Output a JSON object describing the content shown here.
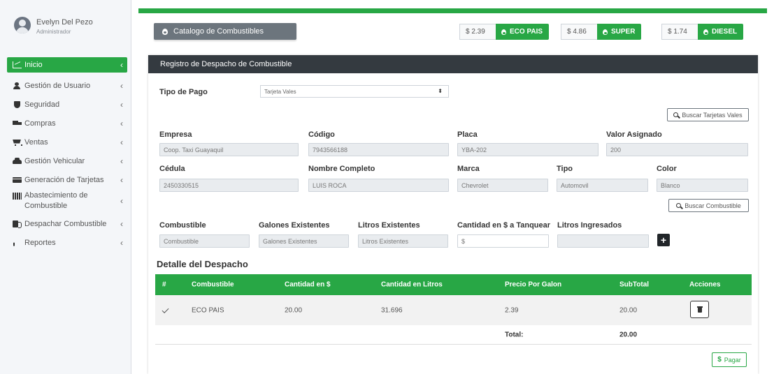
{
  "user": {
    "name": "Evelyn Del Pezo",
    "role": "Administrador"
  },
  "sidebar": {
    "items": [
      {
        "label": "Inicio",
        "icon": "chart-line-icon",
        "active": true
      },
      {
        "label": "Gestión de Usuario",
        "icon": "user-icon"
      },
      {
        "label": "Seguridad",
        "icon": "shield-icon"
      },
      {
        "label": "Compras",
        "icon": "truck-icon"
      },
      {
        "label": "Ventas",
        "icon": "cart-icon"
      },
      {
        "label": "Gestión Vehicular",
        "icon": "car-icon"
      },
      {
        "label": "Generación de Tarjetas",
        "icon": "credit-card-icon"
      },
      {
        "label": "Abastecimiento de Combustible",
        "icon": "fuel-station-icon"
      },
      {
        "label": "Despachar Combustible",
        "icon": "fuel-dispenser-icon"
      },
      {
        "label": "Reportes",
        "icon": "bar-chart-icon"
      }
    ]
  },
  "header": {
    "catalog_button": "Catalogo de Combustibles",
    "prices": [
      {
        "value": "$ 2.39",
        "label": "ECO PAIS"
      },
      {
        "value": "$ 4.86",
        "label": "SUPER"
      },
      {
        "value": "$ 1.74",
        "label": "DIESEL"
      }
    ]
  },
  "form": {
    "title": "Registro de Despacho de Combustible",
    "tipo_pago_label": "Tipo de Pago",
    "tipo_pago_value": "Tarjeta Vales",
    "buscar_tarjetas": "Buscar Tarjetas Vales",
    "empresa_label": "Empresa",
    "empresa_value": "Coop. Taxi Guayaquil",
    "codigo_label": "Código",
    "codigo_value": "7943566188",
    "placa_label": "Placa",
    "placa_value": "YBA-202",
    "valor_label": "Valor Asignado",
    "valor_value": "200",
    "cedula_label": "Cédula",
    "cedula_value": "2450330515",
    "nombre_label": "Nombre Completo",
    "nombre_value": "LUIS ROCA",
    "marca_label": "Marca",
    "marca_value": "Chevrolet",
    "tipo_label": "Tipo",
    "tipo_value": "Automovil",
    "color_label": "Color",
    "color_value": "Blanco",
    "buscar_combustible": "Buscar Combustible",
    "combustible_label": "Combustible",
    "combustible_placeholder": "Combustible",
    "galones_label": "Galones Existentes",
    "galones_placeholder": "Galones Existentes",
    "litros_label": "Litros Existentes",
    "litros_placeholder": "Litros Existentes",
    "cantidad_label": "Cantidad en $ a Tanquear",
    "cantidad_placeholder": "$",
    "litros_ing_label": "Litros Ingresados",
    "add_button": "+"
  },
  "detail": {
    "title": "Detalle del Despacho",
    "columns": [
      "#",
      "Combustible",
      "Cantidad en $",
      "Cantidad en Litros",
      "Precio Por Galon",
      "SubTotal",
      "Acciones"
    ],
    "rows": [
      {
        "combustible": "ECO PAIS",
        "cantidad": "20.00",
        "litros": "31.696",
        "precio": "2.39",
        "subtotal": "20.00"
      }
    ],
    "total_label": "Total:",
    "total_value": "20.00",
    "pay_symbol": "$",
    "pay_label": "Pagar"
  },
  "colors": {
    "accent": "#28a745",
    "dark_header": "#343a40",
    "secondary": "#6c757d"
  }
}
